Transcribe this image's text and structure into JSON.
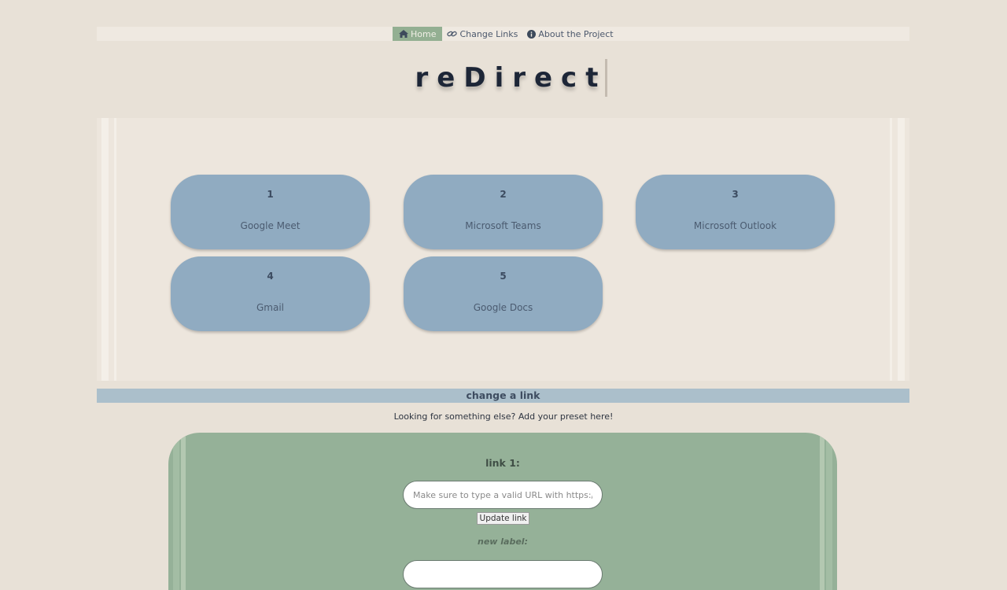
{
  "nav": {
    "items": [
      {
        "label": "Home",
        "icon": "home-icon",
        "active": true
      },
      {
        "label": "Change Links",
        "icon": "link-icon",
        "active": false
      },
      {
        "label": "About the Project",
        "icon": "info-icon",
        "active": false
      }
    ]
  },
  "title": "reDirect",
  "cards": [
    {
      "number": "1",
      "label": "Google Meet"
    },
    {
      "number": "2",
      "label": "Microsoft Teams"
    },
    {
      "number": "3",
      "label": "Microsoft Outlook"
    },
    {
      "number": "4",
      "label": "Gmail"
    },
    {
      "number": "5",
      "label": "Google Docs"
    }
  ],
  "change_section": {
    "heading": "change a link",
    "subtext": "Looking for something else? Add your preset here!"
  },
  "form": {
    "field_title": "link 1:",
    "url_placeholder": "Make sure to type a valid URL with https://",
    "update_button": "Update link",
    "new_label": "new label:"
  },
  "colors": {
    "background": "#e8e1d7",
    "nav_active": "#93af92",
    "card": "#90abc1",
    "section_bar": "#abbfcb",
    "form_panel": "#95b198"
  }
}
